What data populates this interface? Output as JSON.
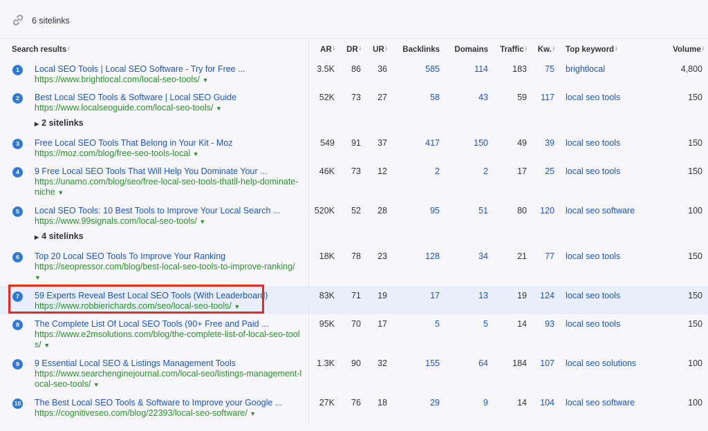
{
  "header": {
    "sitelinks_count": "6 sitelinks",
    "icon": "link-icon"
  },
  "columns": [
    "Search results",
    "AR",
    "DR",
    "UR",
    "Backlinks",
    "Domains",
    "Traffic",
    "Kw.",
    "Top keyword",
    "Volume"
  ],
  "rows": [
    {
      "rank": "1",
      "title": "Local SEO Tools | Local SEO Software - Try for Free ...",
      "url": "https://www.brightlocal.com/local-seo-tools/",
      "sitelinks": "",
      "ar": "3.5K",
      "dr": "86",
      "ur": "36",
      "backlinks": "585",
      "domains": "114",
      "traffic": "183",
      "kw": "75",
      "keyword": "brightlocal",
      "volume": "4,800"
    },
    {
      "rank": "2",
      "title": "Best Local SEO Tools & Software | Local SEO Guide",
      "url": "https://www.localseoguide.com/local-seo-tools/",
      "sitelinks": "2 sitelinks",
      "ar": "52K",
      "dr": "73",
      "ur": "27",
      "backlinks": "58",
      "domains": "43",
      "traffic": "59",
      "kw": "117",
      "keyword": "local seo tools",
      "volume": "150"
    },
    {
      "rank": "3",
      "title": "Free Local SEO Tools That Belong in Your Kit - Moz",
      "url": "https://moz.com/blog/free-seo-tools-local",
      "sitelinks": "",
      "ar": "549",
      "dr": "91",
      "ur": "37",
      "backlinks": "417",
      "domains": "150",
      "traffic": "49",
      "kw": "39",
      "keyword": "local seo tools",
      "volume": "150"
    },
    {
      "rank": "4",
      "title": "9 Free Local SEO Tools That Will Help You Dominate Your ...",
      "url": "https://unamo.com/blog/seo/free-local-seo-tools-thatll-help-dominate-niche",
      "sitelinks": "",
      "ar": "46K",
      "dr": "73",
      "ur": "12",
      "backlinks": "2",
      "domains": "2",
      "traffic": "17",
      "kw": "25",
      "keyword": "local seo tools",
      "volume": "150"
    },
    {
      "rank": "5",
      "title": "Local SEO Tools: 10 Best Tools to Improve Your Local Search ...",
      "url": "https://www.99signals.com/local-seo-tools/",
      "sitelinks": "4 sitelinks",
      "ar": "520K",
      "dr": "52",
      "ur": "28",
      "backlinks": "95",
      "domains": "51",
      "traffic": "80",
      "kw": "120",
      "keyword": "local seo software",
      "volume": "100"
    },
    {
      "rank": "6",
      "title": "Top 20 Local SEO Tools To Improve Your Ranking",
      "url": "https://seopressor.com/blog/best-local-seo-tools-to-improve-ranking/",
      "sitelinks": "",
      "ar": "18K",
      "dr": "78",
      "ur": "23",
      "backlinks": "128",
      "domains": "34",
      "traffic": "21",
      "kw": "77",
      "keyword": "local seo tools",
      "volume": "150"
    },
    {
      "rank": "7",
      "title": "59 Experts Reveal Best Local SEO Tools (With Leaderboard)",
      "url": "https://www.robbierichards.com/seo/local-seo-tools/",
      "sitelinks": "",
      "ar": "83K",
      "dr": "71",
      "ur": "19",
      "backlinks": "17",
      "domains": "13",
      "traffic": "19",
      "kw": "124",
      "keyword": "local seo tools",
      "volume": "150"
    },
    {
      "rank": "8",
      "title": "The Complete List Of Local SEO Tools (90+ Free and Paid ...",
      "url": "https://www.e2msolutions.com/blog/the-complete-list-of-local-seo-tools/",
      "sitelinks": "",
      "ar": "95K",
      "dr": "70",
      "ur": "17",
      "backlinks": "5",
      "domains": "5",
      "traffic": "14",
      "kw": "93",
      "keyword": "local seo tools",
      "volume": "150"
    },
    {
      "rank": "9",
      "title": "9 Essential Local SEO & Listings Management Tools",
      "url": "https://www.searchenginejournal.com/local-seo/listings-management-local-seo-tools/",
      "sitelinks": "",
      "ar": "1.3K",
      "dr": "90",
      "ur": "32",
      "backlinks": "155",
      "domains": "64",
      "traffic": "184",
      "kw": "107",
      "keyword": "local seo solutions",
      "volume": "100"
    },
    {
      "rank": "10",
      "title": "The Best Local SEO Tools & Software to Improve your Google ...",
      "url": "https://cognitiveseo.com/blog/22393/local-seo-software/",
      "sitelinks": "",
      "ar": "27K",
      "dr": "76",
      "ur": "18",
      "backlinks": "29",
      "domains": "9",
      "traffic": "14",
      "kw": "104",
      "keyword": "local seo software",
      "volume": "100"
    }
  ],
  "highlight_rank": "7",
  "colors": {
    "link": "#1a55c7",
    "url": "#279327",
    "rank_badge": "#2f7ad6",
    "highlight_border": "#e8291c",
    "highlight_row": "#e8effa"
  }
}
